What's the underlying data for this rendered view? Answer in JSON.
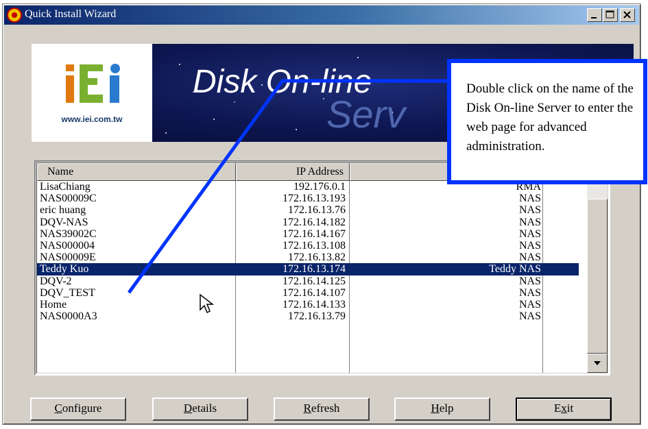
{
  "window": {
    "title": "Quick Install Wizard",
    "controls": [
      "minimize",
      "maximize",
      "close"
    ]
  },
  "banner": {
    "logo_url": "www.iei.com.tw",
    "title": "Disk On-line",
    "subtitle": "Serv"
  },
  "callout": {
    "text": "Double click on the name of the Disk On-line Server to enter the web page for advanced administration."
  },
  "list": {
    "columns": [
      "Name",
      "IP Address",
      ""
    ],
    "rows": [
      {
        "name": "LisaChiang",
        "ip": "192.176.0.1",
        "type": "RMA"
      },
      {
        "name": "NAS00009C",
        "ip": "172.16.13.193",
        "type": "NAS"
      },
      {
        "name": "eric huang",
        "ip": "172.16.13.76",
        "type": "NAS"
      },
      {
        "name": "DQV-NAS",
        "ip": "172.16.14.182",
        "type": "NAS"
      },
      {
        "name": "NAS39002C",
        "ip": "172.16.14.167",
        "type": "NAS"
      },
      {
        "name": "NAS000004",
        "ip": "172.16.13.108",
        "type": "NAS"
      },
      {
        "name": "NAS00009E",
        "ip": "172.16.13.82",
        "type": "NAS"
      },
      {
        "name": "Teddy Kuo",
        "ip": "172.16.13.174",
        "type": "Teddy NAS",
        "selected": true
      },
      {
        "name": "DQV-2",
        "ip": "172.16.14.125",
        "type": "NAS"
      },
      {
        "name": "DQV_TEST",
        "ip": "172.16.14.107",
        "type": "NAS"
      },
      {
        "name": "Home",
        "ip": "172.16.14.133",
        "type": "NAS"
      },
      {
        "name": "NAS0000A3",
        "ip": "172.16.13.79",
        "type": "NAS"
      }
    ]
  },
  "buttons": {
    "configure": {
      "first": "C",
      "rest": "onfigure"
    },
    "details": {
      "first": "D",
      "rest": "etails"
    },
    "refresh": {
      "first": "R",
      "rest": "efresh"
    },
    "help": {
      "first": "H",
      "rest": "elp"
    },
    "exit": {
      "pre": "E",
      "u": "x",
      "post": "it"
    }
  },
  "colors": {
    "selection": "#0a246a",
    "callout_border": "#0033ff",
    "face": "#d4d0c8"
  }
}
